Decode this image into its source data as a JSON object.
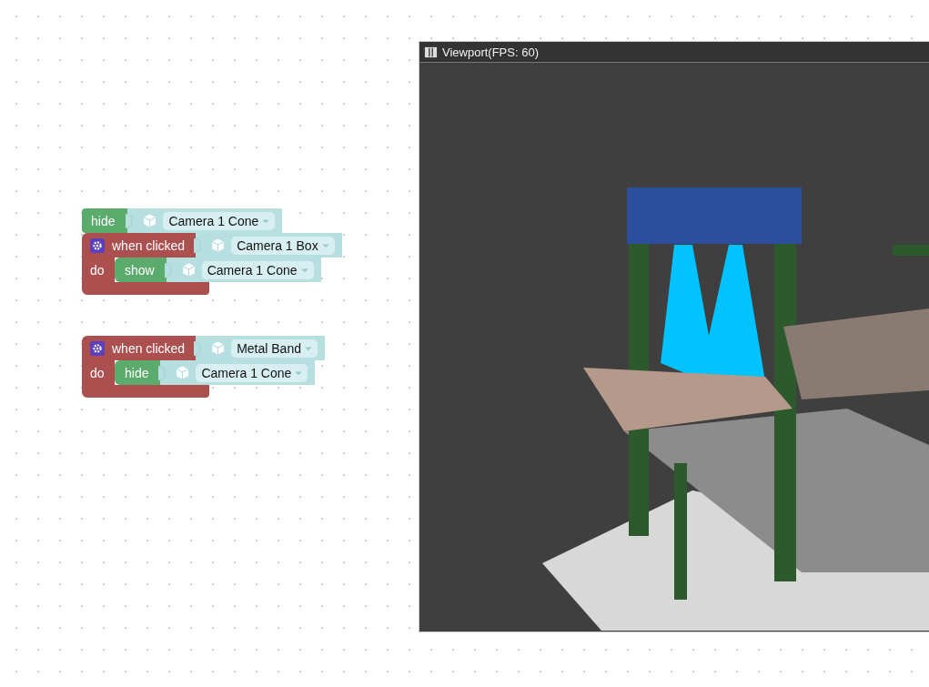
{
  "workspace": {
    "stacks": [
      {
        "blocks": [
          {
            "kind": "action",
            "verb": "hide",
            "target": "Camera 1 Cone"
          },
          {
            "kind": "event",
            "event": "when clicked",
            "object": "Camera 1 Box",
            "do_label": "do",
            "body": [
              {
                "kind": "action",
                "verb": "show",
                "target": "Camera 1 Cone"
              }
            ]
          }
        ]
      },
      {
        "blocks": [
          {
            "kind": "event",
            "event": "when clicked",
            "object": "Metal Band",
            "do_label": "do",
            "body": [
              {
                "kind": "action",
                "verb": "hide",
                "target": "Camera 1 Cone"
              }
            ]
          }
        ]
      }
    ]
  },
  "viewport": {
    "title": "Viewport(FPS: 60)"
  }
}
